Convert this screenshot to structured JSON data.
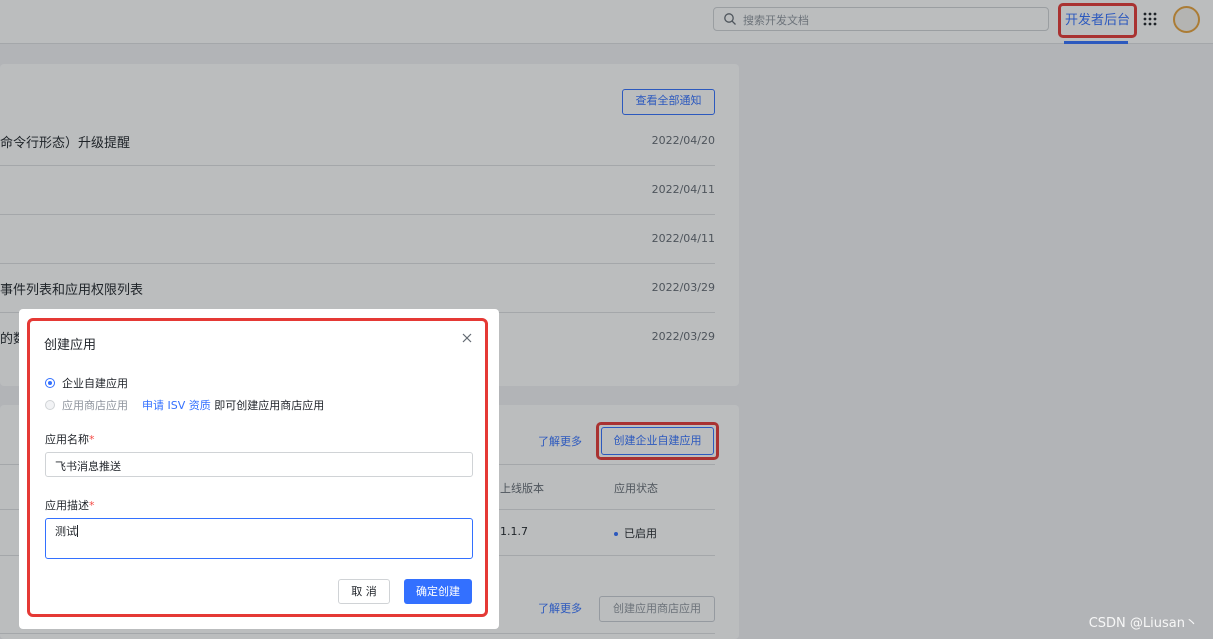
{
  "header": {
    "search_placeholder": "搜索开发文档",
    "dev_console_label": "开发者后台"
  },
  "notifications": {
    "view_all_label": "查看全部通知",
    "items": [
      {
        "title": "命令行形态）升级提醒",
        "date": "2022/04/20"
      },
      {
        "title": "",
        "date": "2022/04/11"
      },
      {
        "title": "",
        "date": "2022/04/11"
      },
      {
        "title": "事件列表和应用权限列表",
        "date": "2022/03/29"
      },
      {
        "title": "的数",
        "date": "2022/03/29"
      }
    ]
  },
  "apps": {
    "learn_more_1": "了解更多",
    "create_custom_app_label": "创建企业自建应用",
    "columns": {
      "version": "上线版本",
      "status": "应用状态"
    },
    "row": {
      "version": "1.1.7",
      "status": "已启用"
    },
    "learn_more_2": "了解更多",
    "create_store_app_label": "创建应用商店应用"
  },
  "modal": {
    "title": "创建应用",
    "close_label": "X",
    "option_custom": "企业自建应用",
    "option_store": "应用商店应用",
    "isv_link": "申请 ISV 资质",
    "isv_suffix": "即可创建应用商店应用",
    "name_label": "应用名称",
    "name_value": "飞书消息推送",
    "desc_label": "应用描述",
    "desc_value": "测试",
    "required_mark": "*",
    "cancel_label": "取 消",
    "confirm_label": "确定创建"
  },
  "watermark": "CSDN @Liusan丶",
  "colors": {
    "accent": "#3370ff",
    "highlight": "#e53935",
    "avatar_ring": "#e8a23c"
  }
}
